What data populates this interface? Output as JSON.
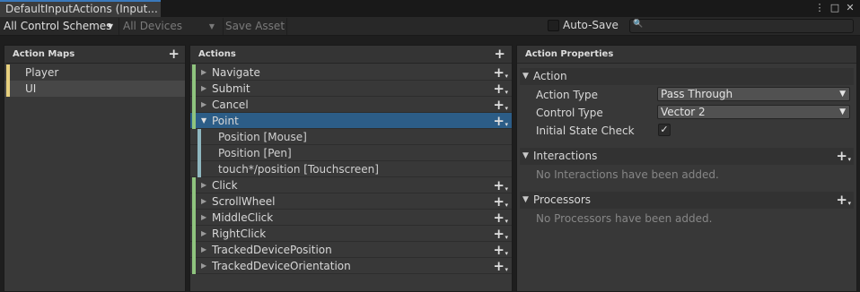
{
  "window": {
    "tab_title": "DefaultInputActions (Input...",
    "menu_glyph": "⋮",
    "maximize_glyph": "□",
    "close_glyph": "✕"
  },
  "toolbar": {
    "control_scheme": "All Control Schemes",
    "devices": "All Devices",
    "save_asset": "Save Asset",
    "auto_save_label": "Auto-Save",
    "auto_save_checked": false,
    "search_value": "",
    "search_icon": "🔍",
    "dropdown_arrow": "▼"
  },
  "action_maps": {
    "title": "Action Maps",
    "add_glyph": "+",
    "items": [
      {
        "label": "Player",
        "selected": false
      },
      {
        "label": "UI",
        "selected": true
      }
    ]
  },
  "actions": {
    "title": "Actions",
    "add_glyph": "+",
    "expanded_glyph": "▼",
    "collapsed_glyph": "▶",
    "items": [
      {
        "label": "Navigate",
        "expanded": false,
        "selected": false,
        "bindings": []
      },
      {
        "label": "Submit",
        "expanded": false,
        "selected": false,
        "bindings": []
      },
      {
        "label": "Cancel",
        "expanded": false,
        "selected": false,
        "bindings": []
      },
      {
        "label": "Point",
        "expanded": true,
        "selected": true,
        "bindings": [
          "Position [Mouse]",
          "Position [Pen]",
          "touch*/position [Touchscreen]"
        ]
      },
      {
        "label": "Click",
        "expanded": false,
        "selected": false,
        "bindings": []
      },
      {
        "label": "ScrollWheel",
        "expanded": false,
        "selected": false,
        "bindings": []
      },
      {
        "label": "MiddleClick",
        "expanded": false,
        "selected": false,
        "bindings": []
      },
      {
        "label": "RightClick",
        "expanded": false,
        "selected": false,
        "bindings": []
      },
      {
        "label": "TrackedDevicePosition",
        "expanded": false,
        "selected": false,
        "bindings": []
      },
      {
        "label": "TrackedDeviceOrientation",
        "expanded": false,
        "selected": false,
        "bindings": []
      }
    ]
  },
  "properties": {
    "title": "Action Properties",
    "action_section": {
      "label": "Action",
      "action_type_label": "Action Type",
      "action_type_value": "Pass Through",
      "control_type_label": "Control Type",
      "control_type_value": "Vector 2",
      "initial_state_label": "Initial State Check",
      "initial_state_checked": true,
      "check_glyph": "✓"
    },
    "interactions": {
      "label": "Interactions",
      "empty_text": "No Interactions have been added."
    },
    "processors": {
      "label": "Processors",
      "empty_text": "No Processors have been added."
    }
  },
  "colors": {
    "selection": "#2c5d87",
    "map_strip": "#e6cf7e",
    "action_strip": "#8fc47e",
    "binding_strip": "#8fb7c0",
    "tab_accent": "#3a79bb"
  }
}
